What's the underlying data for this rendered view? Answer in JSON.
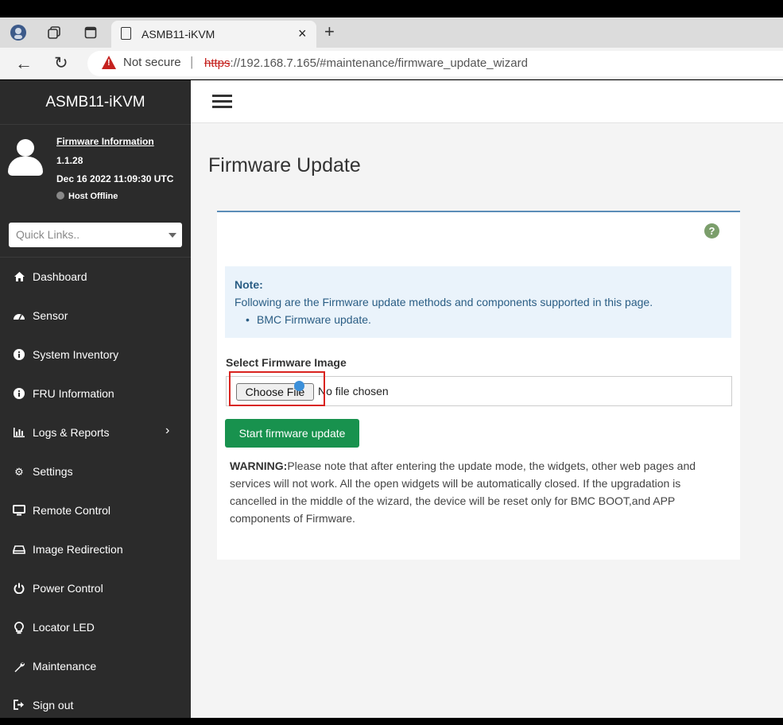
{
  "browser": {
    "tab_title": "ASMB11-iKVM",
    "not_secure": "Not secure",
    "url_scheme": "https",
    "url_rest": "://192.168.7.165/#maintenance/firmware_update_wizard"
  },
  "sidebar": {
    "brand": "ASMB11-iKVM",
    "firmware_link": "Firmware Information",
    "firmware_version": "1.1.28",
    "firmware_date": "Dec 16 2022 11:09:30 UTC",
    "host_status": "Host Offline",
    "quick_links_placeholder": "Quick Links..",
    "items": [
      {
        "label": "Dashboard",
        "icon": "home-icon"
      },
      {
        "label": "Sensor",
        "icon": "gauge-icon"
      },
      {
        "label": "System Inventory",
        "icon": "info-icon"
      },
      {
        "label": "FRU Information",
        "icon": "info-icon"
      },
      {
        "label": "Logs & Reports",
        "icon": "bar-chart-icon"
      },
      {
        "label": "Settings",
        "icon": "gear-icon"
      },
      {
        "label": "Remote Control",
        "icon": "monitor-icon"
      },
      {
        "label": "Image Redirection",
        "icon": "drive-icon"
      },
      {
        "label": "Power Control",
        "icon": "power-icon"
      },
      {
        "label": "Locator LED",
        "icon": "bulb-icon"
      },
      {
        "label": "Maintenance",
        "icon": "wrench-icon"
      },
      {
        "label": "Sign out",
        "icon": "sign-out-icon"
      }
    ]
  },
  "main": {
    "title": "Firmware Update",
    "note_title": "Note:",
    "note_desc": "Following are the Firmware update methods and components supported in this page.",
    "note_bullet": "BMC Firmware update.",
    "select_label": "Select Firmware Image",
    "choose_file": "Choose File",
    "no_file": "No file chosen",
    "start_button": "Start firmware update",
    "warning_label": "WARNING:",
    "warning_text": "Please note that after entering the update mode, the widgets, other web pages and services will not work. All the open widgets will be automatically closed. If the upgradation is cancelled in the middle of the wizard, the device will be reset only for BMC BOOT,and APP components of Firmware."
  },
  "colors": {
    "sidebar_bg": "#2b2b2b",
    "start_button": "#18924e",
    "note_bg": "#eaf3fb",
    "highlight": "#d9231f"
  }
}
